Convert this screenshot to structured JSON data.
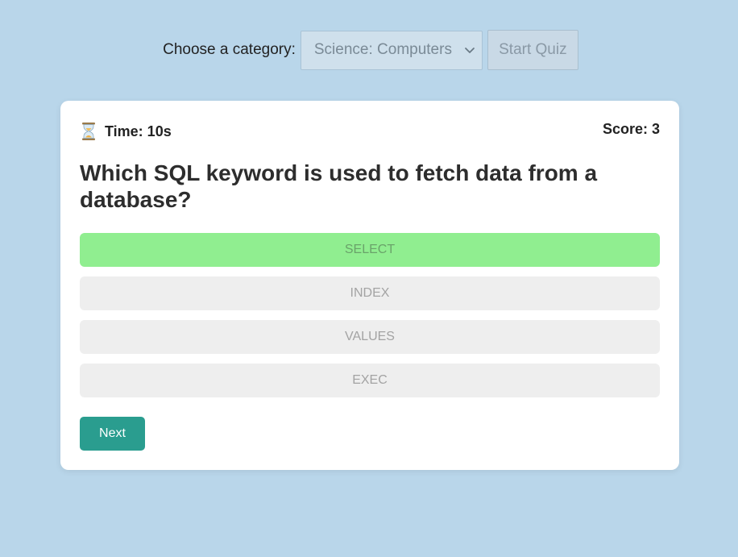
{
  "header": {
    "category_label": "Choose a category:",
    "category_selected": "Science: Computers",
    "start_button": "Start Quiz"
  },
  "quiz": {
    "timer_text": "Time: 10s",
    "score_text": "Score: 3",
    "question": "Which SQL keyword is used to fetch data from a database?",
    "answers": [
      {
        "label": "SELECT",
        "state": "correct"
      },
      {
        "label": "INDEX",
        "state": "disabled"
      },
      {
        "label": "VALUES",
        "state": "disabled"
      },
      {
        "label": "EXEC",
        "state": "disabled"
      }
    ],
    "next_button": "Next"
  },
  "colors": {
    "background": "#b9d6ea",
    "correct": "#90ee90",
    "accent": "#2a9d8f"
  },
  "icons": {
    "timer": "hourglass-icon",
    "dropdown": "chevron-down-icon"
  }
}
